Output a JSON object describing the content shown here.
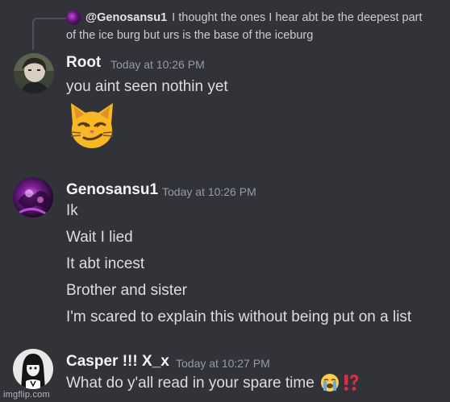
{
  "reply": {
    "author": "@Genosansu1",
    "text_line1": "I thought the ones I hear abt be the deepest part",
    "text_line2": "of the ice burg but urs is the base of the iceburg"
  },
  "messages": [
    {
      "author": "Root",
      "timestamp": "Today at 10:26 PM",
      "lines": [
        "you aint seen nothin yet"
      ],
      "emoji": "smirking-cat-emoji"
    },
    {
      "author": "Genosansu1",
      "timestamp": "Today at 10:26 PM",
      "lines": [
        "Ik",
        "Wait I lied",
        "It abt incest",
        "Brother and sister",
        "I'm scared to explain this without being put on a list"
      ]
    },
    {
      "author": "Casper !!! X_x",
      "timestamp": "Today at 10:27 PM",
      "lines": [
        "What do y'all read in your spare time"
      ],
      "trailing_emojis": [
        "loudly-crying-face-emoji",
        "exclamation-question-mark-emoji"
      ]
    }
  ],
  "watermark": "imgflip.com",
  "colors": {
    "background": "#313338",
    "username": "#f2f3f5",
    "timestamp": "#949ba4",
    "message_text": "#dbdee1"
  }
}
